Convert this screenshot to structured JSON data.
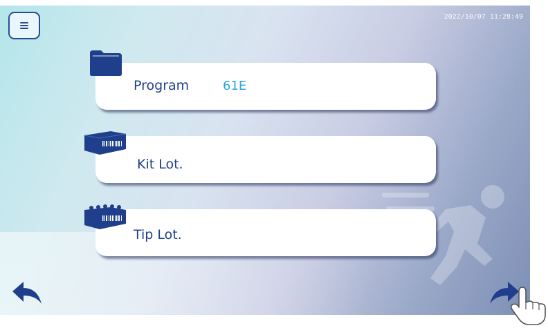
{
  "header": {
    "menu_icon": "hamburger-menu-icon",
    "datetime": "2022/10/07  11:28:49"
  },
  "cards": [
    {
      "icon": "folder-icon",
      "label": "Program",
      "value": "61E"
    },
    {
      "icon": "kit-box-barcode-icon",
      "label": "Kit Lot.",
      "value": ""
    },
    {
      "icon": "tip-rack-barcode-icon",
      "label": "Tip Lot.",
      "value": ""
    }
  ],
  "background_icon": "running-man-icon",
  "footer": {
    "back_icon": "back-arrow-icon",
    "next_icon": "forward-arrow-icon",
    "pointer_icon": "hand-pointer-icon"
  },
  "colors": {
    "primary": "#1f3f8c",
    "accent_value": "#29a8d8",
    "card_background": "#ffffff"
  }
}
